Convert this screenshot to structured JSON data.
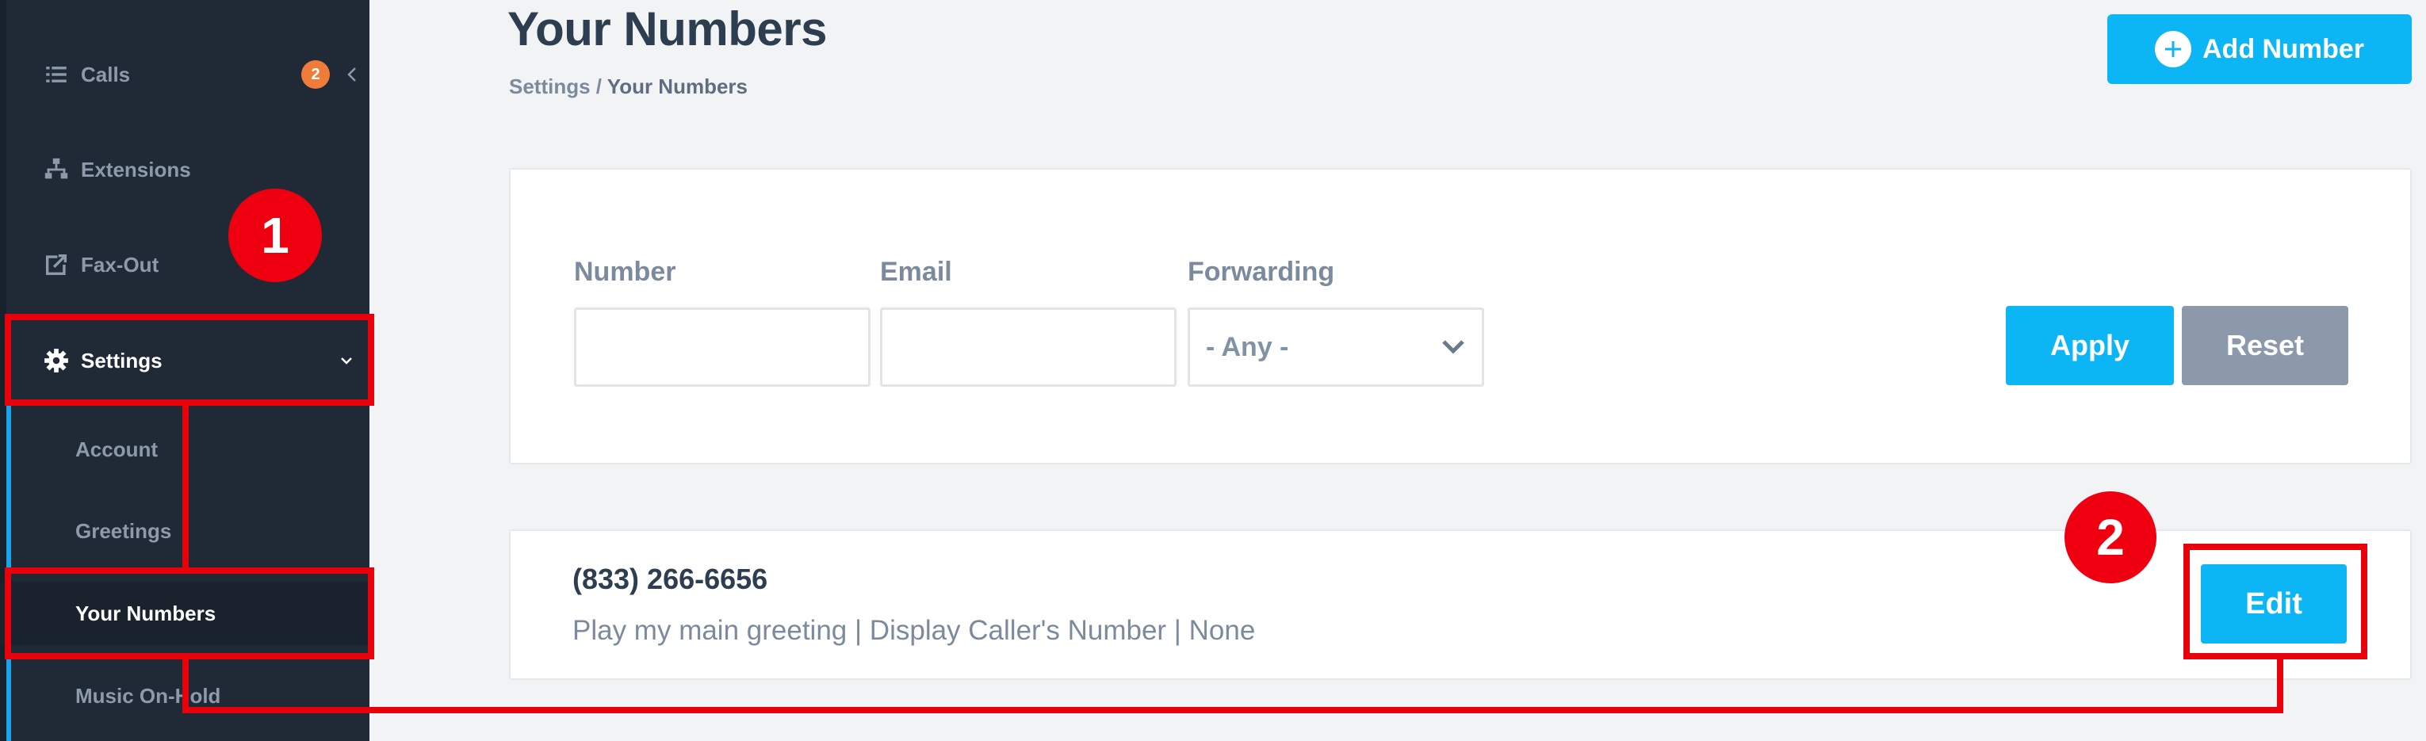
{
  "sidebar": {
    "calls": {
      "label": "Calls",
      "badge": "2",
      "icon": "list-icon"
    },
    "extensions": {
      "label": "Extensions",
      "icon": "hierarchy-icon"
    },
    "fax_out": {
      "label": "Fax-Out",
      "icon": "share-out-icon"
    },
    "settings": {
      "label": "Settings",
      "icon": "gear-icon"
    },
    "sub_items": [
      "Account",
      "Greetings",
      "Your Numbers",
      "Music On-Hold"
    ]
  },
  "header": {
    "title": "Your Numbers",
    "breadcrumb": {
      "parent": "Settings",
      "separator": " / ",
      "current": "Your Numbers"
    },
    "add_button_label": "Add Number"
  },
  "filters": {
    "number_label": "Number",
    "number_value": "",
    "email_label": "Email",
    "email_value": "",
    "forwarding_label": "Forwarding",
    "forwarding_selected": "- Any -",
    "apply_label": "Apply",
    "reset_label": "Reset"
  },
  "numbers": [
    {
      "number": "(833) 266-6656",
      "description": "Play my main greeting | Display Caller's Number | None",
      "edit_label": "Edit"
    }
  ],
  "annotations": {
    "step1": "1",
    "step2": "2"
  },
  "colors": {
    "sidebar_bg": "#1f2a36",
    "accent": "#0cb5f4",
    "reset": "#8b99ab",
    "badge": "#f07c3a",
    "annotation_red": "#e8000b"
  }
}
